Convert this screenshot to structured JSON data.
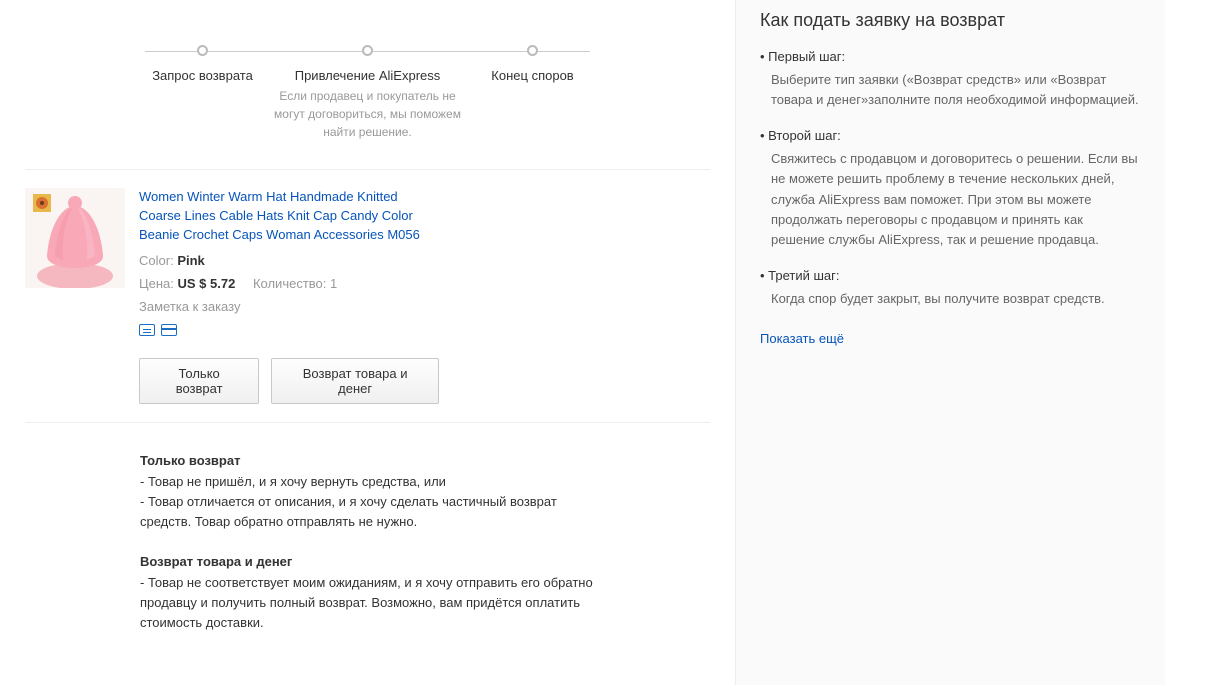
{
  "stepper": {
    "s1": {
      "label": "Запрос возврата",
      "sub": ""
    },
    "s2": {
      "label": "Привлечение AliExpress",
      "sub": "Если продавец и покупатель не могут договориться, мы поможем найти решение."
    },
    "s3": {
      "label": "Конец споров",
      "sub": ""
    }
  },
  "product": {
    "name": "Women Winter Warm Hat Handmade Knitted Coarse Lines Cable Hats Knit Cap Candy Color Beanie Crochet Caps Woman Accessories M056",
    "color_label": "Color:",
    "color_value": "Pink",
    "price_label": "Цена:",
    "price_value": "US $ 5.72",
    "qty_label": "Количество:",
    "qty_value": "1",
    "note": "Заметка к заказу"
  },
  "buttons": {
    "refund_only": "Только возврат",
    "return_and_refund": "Возврат товара и денег"
  },
  "explain": {
    "a_title": "Только возврат",
    "a_l1": "- Товар не пришёл, и я хочу вернуть средства, или",
    "a_l2": "- Товар отличается от описания, и я хочу сделать частичный возврат средств. Товар обратно отправлять не нужно.",
    "b_title": "Возврат товара и денег",
    "b_l1": "- Товар не соответствует моим ожиданиям, и я хочу отправить его обратно продавцу и получить полный возврат. Возможно, вам придётся оплатить стоимость доставки."
  },
  "sidebar": {
    "title": "Как подать заявку на возврат",
    "step1_head": "Первый шаг:",
    "step1_body": "Выберите тип заявки («Возврат средств» или «Возврат товара и денег»заполните поля необходимой информацией.",
    "step2_head": "Второй шаг:",
    "step2_body": "Свяжитесь с продавцом и договоритесь о решении. Если вы не можете решить проблему в течение нескольких дней, служба AliExpress вам поможет. При этом вы можете продолжать переговоры с продавцом и принять как решение службы AliExpress, так и решение продавца.",
    "step3_head": "Третий шаг:",
    "step3_body": "Когда спор будет закрыт, вы получите возврат средств.",
    "show_more": "Показать ещё"
  }
}
